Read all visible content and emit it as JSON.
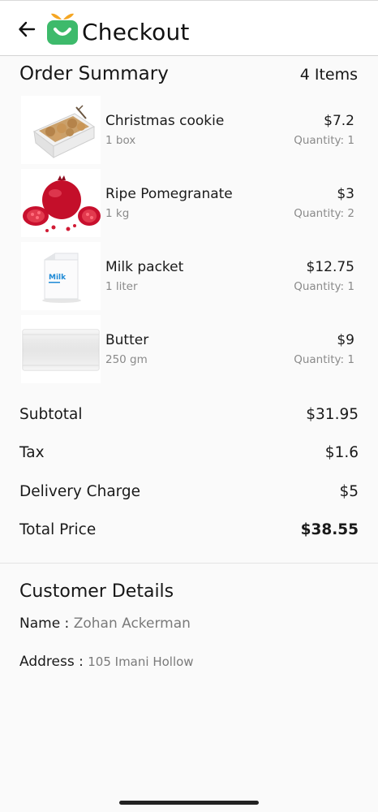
{
  "header": {
    "title": "Checkout",
    "back_icon": "arrow-left-icon",
    "logo_icon": "shopping-basket-logo",
    "brand_colors": {
      "green": "#3dba6b",
      "orange": "#f5a623"
    }
  },
  "summary": {
    "title": "Order Summary",
    "items_count": "4 Items",
    "items": [
      {
        "name": "Christmas cookie",
        "unit": "1 box",
        "price": "$7.2",
        "quantity": "Quantity: 1",
        "image": "cookie-box-image"
      },
      {
        "name": "Ripe Pomegranate",
        "unit": "1 kg",
        "price": "$3",
        "quantity": "Quantity: 2",
        "image": "pomegranate-image"
      },
      {
        "name": "Milk packet",
        "unit": "1 liter",
        "price": "$12.75",
        "quantity": "Quantity: 1",
        "image": "milk-packet-image",
        "image_text": "Milk"
      },
      {
        "name": "Butter",
        "unit": "250 gm",
        "price": "$9",
        "quantity": "Quantity: 1",
        "image": "butter-pack-image"
      }
    ]
  },
  "totals": {
    "subtotal_label": "Subtotal",
    "subtotal": "$31.95",
    "tax_label": "Tax",
    "tax": "$1.6",
    "delivery_label": "Delivery Charge",
    "delivery": "$5",
    "total_label": "Total Price",
    "total": "$38.55"
  },
  "customer": {
    "title": "Customer Details",
    "name_label": "Name : ",
    "name": "Zohan Ackerman",
    "address_label": "Address : ",
    "address": "105 Imani Hollow"
  }
}
